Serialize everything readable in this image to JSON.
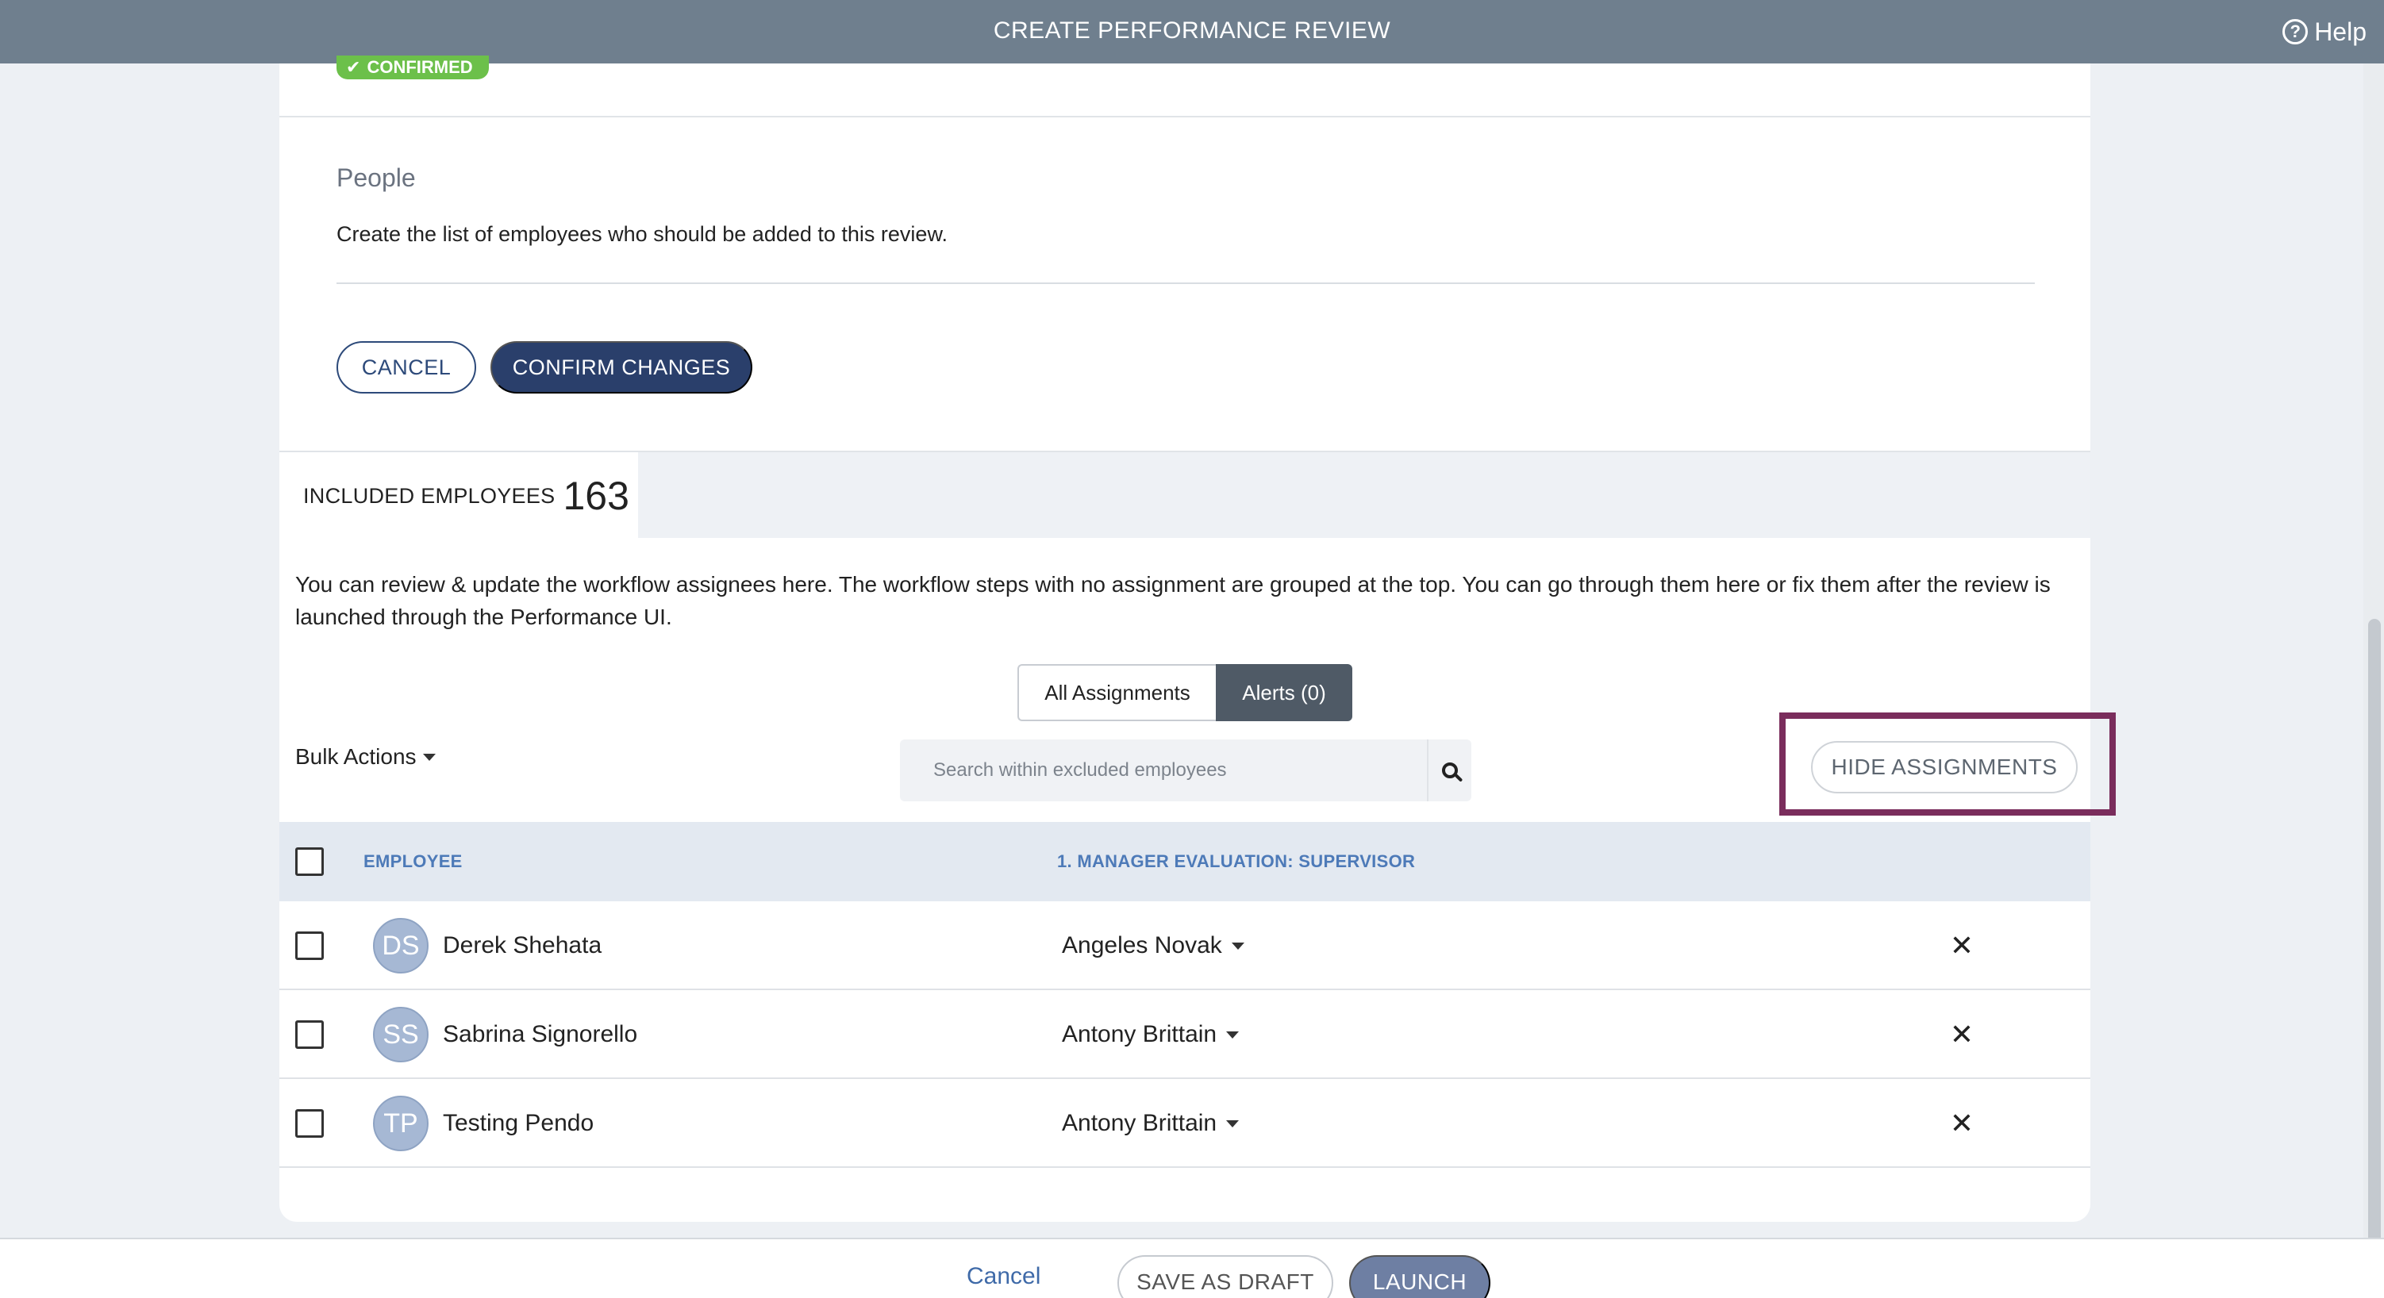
{
  "header": {
    "title": "CREATE PERFORMANCE REVIEW",
    "help_label": "Help",
    "help_icon": "?"
  },
  "status_badge": {
    "label": "CONFIRMED",
    "icon": "✔",
    "color": "#6cc04a"
  },
  "people_section": {
    "heading": "People",
    "description": "Create the list of employees who should be added to this review.",
    "cancel_label": "CANCEL",
    "confirm_label": "CONFIRM CHANGES"
  },
  "included_tab": {
    "label": "INCLUDED EMPLOYEES",
    "count": "163"
  },
  "assignments": {
    "description": "You can review & update the workflow assignees here. The workflow steps with no assignment are grouped at the top. You can go through them here or fix them after the review is launched through the Performance UI.",
    "tabs": [
      {
        "label": "All Assignments",
        "active": false
      },
      {
        "label": "Alerts (0)",
        "active": true
      }
    ],
    "bulk_actions_label": "Bulk Actions",
    "search_placeholder": "Search within excluded employees",
    "hide_assignments_label": "HIDE ASSIGNMENTS",
    "highlight_color": "#7a2d5c"
  },
  "table": {
    "columns": [
      "EMPLOYEE",
      "1. MANAGER EVALUATION: SUPERVISOR"
    ],
    "rows": [
      {
        "initials": "DS",
        "name": "Derek Shehata",
        "assignee": "Angeles Novak"
      },
      {
        "initials": "SS",
        "name": "Sabrina Signorello",
        "assignee": "Antony Brittain"
      },
      {
        "initials": "TP",
        "name": "Testing Pendo",
        "assignee": "Antony Brittain"
      }
    ]
  },
  "footer": {
    "cancel_label": "Cancel",
    "save_draft_label": "SAVE AS DRAFT",
    "launch_label": "LAUNCH"
  },
  "colors": {
    "topbar": "#6f7f8e",
    "primary": "#2a3f6b",
    "header_text": "#4d7ab8",
    "launch": "#6e7fa3"
  }
}
